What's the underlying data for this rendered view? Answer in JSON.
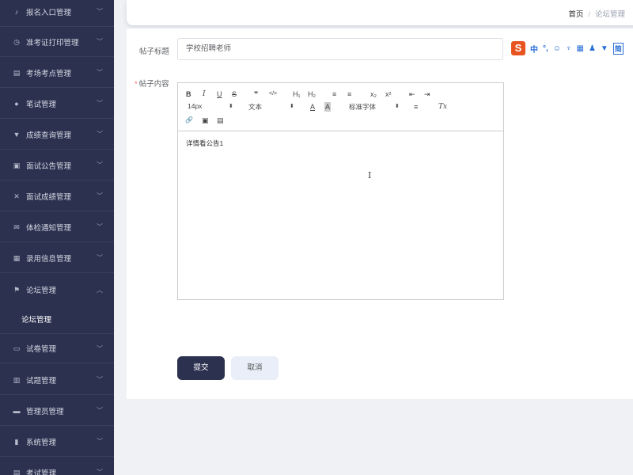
{
  "sidebar": {
    "items": [
      {
        "label": "报名入口管理",
        "icon": "mic-icon",
        "glyph": "♪",
        "arrow": "﹀"
      },
      {
        "label": "准考证打印管理",
        "icon": "clock-icon",
        "glyph": "◷",
        "arrow": "﹀"
      },
      {
        "label": "考场考点管理",
        "icon": "document-icon",
        "glyph": "▤",
        "arrow": "﹀"
      },
      {
        "label": "笔试管理",
        "icon": "user-icon",
        "glyph": "●",
        "arrow": "﹀"
      },
      {
        "label": "成绩查询管理",
        "icon": "cup-icon",
        "glyph": "▼",
        "arrow": "﹀"
      },
      {
        "label": "面试公告管理",
        "icon": "notice-icon",
        "glyph": "▣",
        "arrow": "﹀"
      },
      {
        "label": "面试成绩管理",
        "icon": "bell-off-icon",
        "glyph": "✕",
        "arrow": "﹀"
      },
      {
        "label": "体检通知管理",
        "icon": "mail-icon",
        "glyph": "✉",
        "arrow": "﹀"
      },
      {
        "label": "录用信息管理",
        "icon": "grid-icon",
        "glyph": "▦",
        "arrow": "﹀"
      },
      {
        "label": "论坛管理",
        "icon": "flag-icon",
        "glyph": "⚑",
        "arrow": "︿"
      },
      {
        "label": "试卷管理",
        "icon": "monitor-icon",
        "glyph": "▭",
        "arrow": "﹀"
      },
      {
        "label": "试题管理",
        "icon": "bars-icon",
        "glyph": "▥",
        "arrow": "﹀"
      },
      {
        "label": "管理员管理",
        "icon": "printer-icon",
        "glyph": "▬",
        "arrow": "﹀"
      },
      {
        "label": "系统管理",
        "icon": "chart-icon",
        "glyph": "▮",
        "arrow": "﹀"
      },
      {
        "label": "考试管理",
        "icon": "exam-icon",
        "glyph": "▤",
        "arrow": "﹀"
      }
    ],
    "submenu": {
      "label": "论坛管理"
    }
  },
  "breadcrumb": {
    "home": "首页",
    "sep": "/",
    "current": "论坛管理"
  },
  "form": {
    "title_label": "帖子标题",
    "title_value": "学校招聘老师",
    "content_label": "帖子内容",
    "content_required": "*",
    "editor_text": "详情看公告1",
    "cursor_glyph": "I",
    "submit": "提交",
    "cancel": "取消"
  },
  "toolbar": {
    "bold": "B",
    "italic": "I",
    "underline": "U",
    "strike": "S",
    "quote": "❞",
    "code": "</>",
    "h1": "H₁",
    "h2": "H₂",
    "ol": "≡",
    "ul": "≡",
    "sub": "x₂",
    "sup": "x²",
    "outdent": "⇤",
    "indent": "⇥",
    "size": "14px",
    "type": "文本",
    "font": "标准字体",
    "color": "A",
    "bg": "A",
    "align": "≡",
    "clear": "Tx",
    "link": "🔗",
    "image": "▣",
    "video": "▤",
    "caret": "⬍"
  },
  "ime": {
    "logo": "S",
    "lang": "中",
    "punct": "°,",
    "emoji": "☺",
    "voice": "♆",
    "keyboard": "▦",
    "user": "♟",
    "shirt": "▼",
    "simp": "简"
  }
}
